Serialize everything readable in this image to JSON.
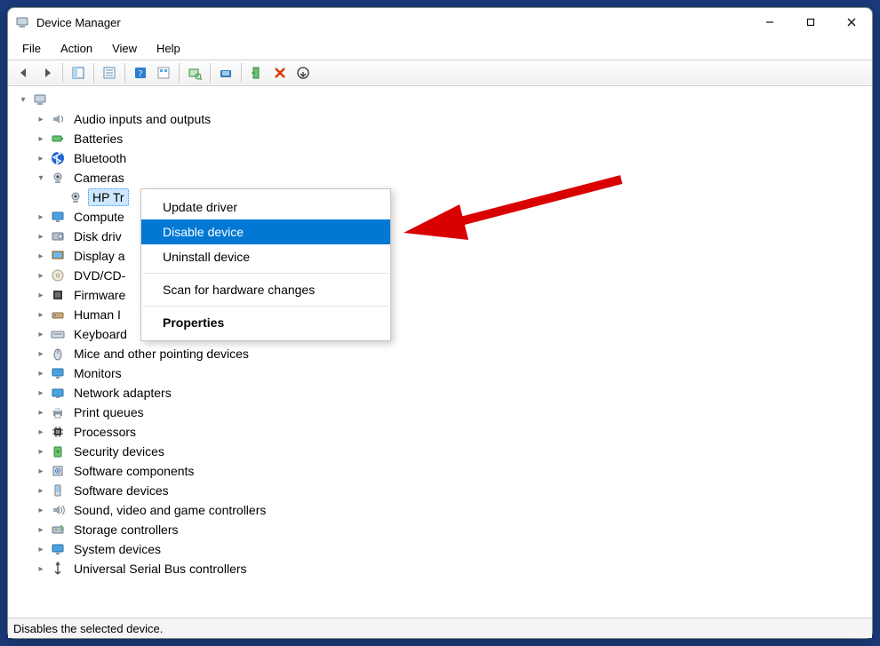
{
  "window": {
    "title": "Device Manager"
  },
  "menubar": {
    "items": [
      "File",
      "Action",
      "View",
      "Help"
    ]
  },
  "tree": {
    "root_icon": "computer-icon",
    "categories": [
      {
        "icon": "audio-icon",
        "label": "Audio inputs and outputs"
      },
      {
        "icon": "battery-icon",
        "label": "Batteries"
      },
      {
        "icon": "bluetooth-icon",
        "label": "Bluetooth"
      },
      {
        "icon": "camera-icon",
        "label": "Cameras",
        "expanded": true,
        "children": [
          {
            "icon": "webcam-icon",
            "label": "HP Tr",
            "selected": true
          }
        ]
      },
      {
        "icon": "monitor-icon",
        "label": "Compute"
      },
      {
        "icon": "disk-icon",
        "label": "Disk driv"
      },
      {
        "icon": "display-icon",
        "label": "Display a"
      },
      {
        "icon": "dvd-icon",
        "label": "DVD/CD-"
      },
      {
        "icon": "firmware-icon",
        "label": "Firmware"
      },
      {
        "icon": "hid-icon",
        "label": "Human I"
      },
      {
        "icon": "keyboard-icon",
        "label": "Keyboard"
      },
      {
        "icon": "mouse-icon",
        "label": "Mice and other pointing devices"
      },
      {
        "icon": "monitor-icon",
        "label": "Monitors"
      },
      {
        "icon": "network-icon",
        "label": "Network adapters"
      },
      {
        "icon": "printer-icon",
        "label": "Print queues"
      },
      {
        "icon": "cpu-icon",
        "label": "Processors"
      },
      {
        "icon": "security-icon",
        "label": "Security devices"
      },
      {
        "icon": "softcomp-icon",
        "label": "Software components"
      },
      {
        "icon": "softdev-icon",
        "label": "Software devices"
      },
      {
        "icon": "sound-icon",
        "label": "Sound, video and game controllers"
      },
      {
        "icon": "storage-icon",
        "label": "Storage controllers"
      },
      {
        "icon": "system-icon",
        "label": "System devices"
      },
      {
        "icon": "usb-icon",
        "label": "Universal Serial Bus controllers"
      }
    ]
  },
  "context_menu": {
    "items": [
      {
        "label": "Update driver"
      },
      {
        "label": "Disable device",
        "highlight": true
      },
      {
        "label": "Uninstall device"
      },
      {
        "sep": true
      },
      {
        "label": "Scan for hardware changes"
      },
      {
        "sep": true
      },
      {
        "label": "Properties",
        "bold": true
      }
    ]
  },
  "statusbar": {
    "text": "Disables the selected device."
  }
}
